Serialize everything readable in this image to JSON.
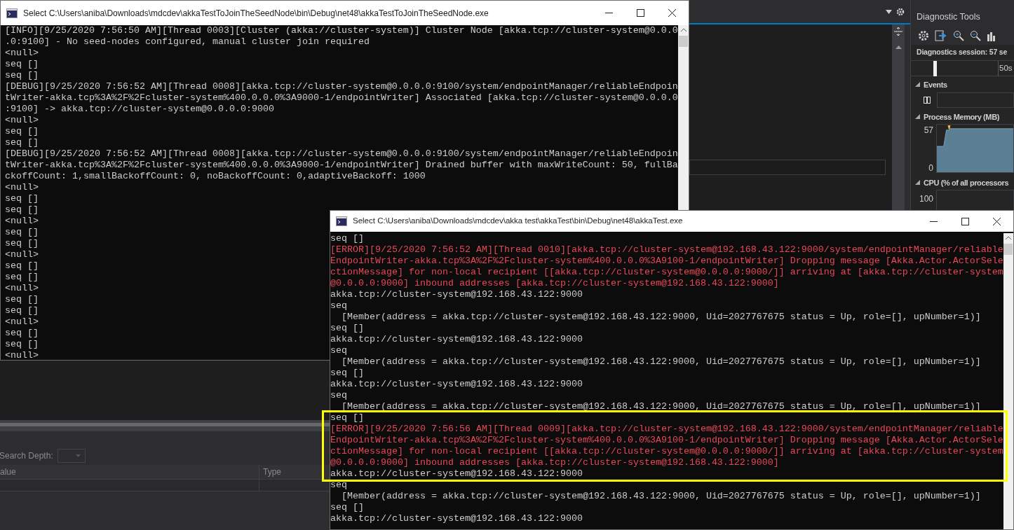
{
  "lower_panel": {
    "search_depth_label": "Search Depth:",
    "columns": [
      "alue",
      "Type"
    ]
  },
  "diagnostic_tools": {
    "title": "Diagnostic Tools",
    "session": "Diagnostics session: 57 se",
    "timeline_label": "50s",
    "sections": [
      {
        "kind": "events",
        "title": "Events",
        "expanded": true
      },
      {
        "kind": "memory",
        "title": "Process Memory (MB)",
        "expanded": true,
        "axis_labels": [
          "57",
          "0"
        ]
      },
      {
        "kind": "cpu",
        "title": "CPU (% of all processors",
        "expanded": true,
        "axis_labels": [
          "100"
        ]
      }
    ]
  },
  "console_windows": [
    {
      "title": "Select C:\\Users\\aniba\\Downloads\\mdcdev\\akkaTestToJoinTheSeedNode\\bin\\Debug\\net48\\akkaTestToJoinTheSeedNode.exe",
      "sections": [
        {
          "highlighted": false,
          "lines": [
            {
              "kind": "output",
              "text": "[INFO][9/25/2020 7:56:50 AM][Thread 0003][Cluster (akka://cluster-system)] Cluster Node [akka.tcp://cluster-system@0.0.0"
            },
            {
              "kind": "output",
              "text": ".0:9100] - No seed-nodes configured, manual cluster join required"
            },
            {
              "kind": "output",
              "text": "<null>"
            },
            {
              "kind": "output",
              "text": "seq []"
            },
            {
              "kind": "output",
              "text": "seq []"
            },
            {
              "kind": "output",
              "text": "[DEBUG][9/25/2020 7:56:52 AM][Thread 0008][akka.tcp://cluster-system@0.0.0.0:9100/system/endpointManager/reliableEndpoin"
            },
            {
              "kind": "output",
              "text": "tWriter-akka.tcp%3A%2F%2Fcluster-system%400.0.0.0%3A9000-1/endpointWriter] Associated [akka.tcp://cluster-system@0.0.0.0"
            },
            {
              "kind": "output",
              "text": ":9100] -> akka.tcp://cluster-system@0.0.0.0:9000"
            },
            {
              "kind": "output",
              "text": "<null>"
            },
            {
              "kind": "output",
              "text": "seq []"
            },
            {
              "kind": "output",
              "text": "seq []"
            },
            {
              "kind": "output",
              "text": "[DEBUG][9/25/2020 7:56:52 AM][Thread 0008][akka.tcp://cluster-system@0.0.0.0:9100/system/endpointManager/reliableEndpoin"
            },
            {
              "kind": "output",
              "text": "tWriter-akka.tcp%3A%2F%2Fcluster-system%400.0.0.0%3A9000-1/endpointWriter] Drained buffer with maxWriteCount: 50, fullBa"
            },
            {
              "kind": "output",
              "text": "ckoffCount: 1,smallBackoffCount: 0, noBackoffCount: 0,adaptiveBackoff: 1000"
            },
            {
              "kind": "output",
              "text": "<null>"
            },
            {
              "kind": "output",
              "text": "seq []"
            },
            {
              "kind": "output",
              "text": "seq []"
            },
            {
              "kind": "output",
              "text": "<null>"
            },
            {
              "kind": "output",
              "text": "seq []"
            },
            {
              "kind": "output",
              "text": "seq []"
            },
            {
              "kind": "output",
              "text": "<null>"
            },
            {
              "kind": "output",
              "text": "seq []"
            },
            {
              "kind": "output",
              "text": "seq []"
            },
            {
              "kind": "output",
              "text": "<null>"
            },
            {
              "kind": "output",
              "text": "seq []"
            },
            {
              "kind": "output",
              "text": "seq []"
            },
            {
              "kind": "output",
              "text": "<null>"
            },
            {
              "kind": "output",
              "text": "seq []"
            },
            {
              "kind": "output",
              "text": "seq []"
            },
            {
              "kind": "output",
              "text": "<null>"
            }
          ]
        }
      ]
    },
    {
      "title": "Select C:\\Users\\aniba\\Downloads\\mdcdev\\akka test\\akkaTest\\bin\\Debug\\net48\\akkaTest.exe",
      "sections": [
        {
          "highlighted": false,
          "lines": [
            {
              "kind": "output",
              "text": "seq []"
            },
            {
              "kind": "error",
              "text": "[ERROR][9/25/2020 7:56:52 AM][Thread 0010][akka.tcp://cluster-system@192.168.43.122:9000/system/endpointManager/reliable"
            },
            {
              "kind": "error",
              "text": "EndpointWriter-akka.tcp%3A%2F%2Fcluster-system%400.0.0.0%3A9100-1/endpointWriter] Dropping message [Akka.Actor.ActorSele"
            },
            {
              "kind": "error",
              "text": "ctionMessage] for non-local recipient [[akka.tcp://cluster-system@0.0.0.0:9000/]] arriving at [akka.tcp://cluster-system"
            },
            {
              "kind": "error",
              "text": "@0.0.0.0:9000] inbound addresses [akka.tcp://cluster-system@192.168.43.122:9000]"
            },
            {
              "kind": "output",
              "text": "akka.tcp://cluster-system@192.168.43.122:9000"
            },
            {
              "kind": "output",
              "text": "seq"
            },
            {
              "kind": "output",
              "text": "  [Member(address = akka.tcp://cluster-system@192.168.43.122:9000, Uid=2027767675 status = Up, role=[], upNumber=1)]"
            },
            {
              "kind": "output",
              "text": "seq []"
            },
            {
              "kind": "output",
              "text": "akka.tcp://cluster-system@192.168.43.122:9000"
            },
            {
              "kind": "output",
              "text": "seq"
            },
            {
              "kind": "output",
              "text": "  [Member(address = akka.tcp://cluster-system@192.168.43.122:9000, Uid=2027767675 status = Up, role=[], upNumber=1)]"
            },
            {
              "kind": "output",
              "text": "seq []"
            },
            {
              "kind": "output",
              "text": "akka.tcp://cluster-system@192.168.43.122:9000"
            },
            {
              "kind": "output",
              "text": "seq"
            },
            {
              "kind": "output",
              "text": "  [Member(address = akka.tcp://cluster-system@192.168.43.122:9000, Uid=2027767675 status = Up, role=[], upNumber=1)]"
            }
          ]
        },
        {
          "highlighted": true,
          "lines": [
            {
              "kind": "output",
              "text": "seq []"
            },
            {
              "kind": "error",
              "text": "[ERROR][9/25/2020 7:56:56 AM][Thread 0009][akka.tcp://cluster-system@192.168.43.122:9000/system/endpointManager/reliable"
            },
            {
              "kind": "error",
              "text": "EndpointWriter-akka.tcp%3A%2F%2Fcluster-system%400.0.0.0%3A9100-1/endpointWriter] Dropping message [Akka.Actor.ActorSele"
            },
            {
              "kind": "error",
              "text": "ctionMessage] for non-local recipient [[akka.tcp://cluster-system@0.0.0.0:9000/]] arriving at [akka.tcp://cluster-system"
            },
            {
              "kind": "error",
              "text": "@0.0.0.0:9000] inbound addresses [akka.tcp://cluster-system@192.168.43.122:9000]"
            },
            {
              "kind": "output",
              "text": "akka.tcp://cluster-system@192.168.43.122:9000"
            }
          ]
        },
        {
          "highlighted": false,
          "lines": [
            {
              "kind": "output",
              "text": "seq"
            },
            {
              "kind": "output",
              "text": "  [Member(address = akka.tcp://cluster-system@192.168.43.122:9000, Uid=2027767675 status = Up, role=[], upNumber=1)]"
            },
            {
              "kind": "output",
              "text": "seq []"
            },
            {
              "kind": "output",
              "text": "akka.tcp://cluster-system@192.168.43.122:9000"
            }
          ]
        }
      ]
    }
  ]
}
